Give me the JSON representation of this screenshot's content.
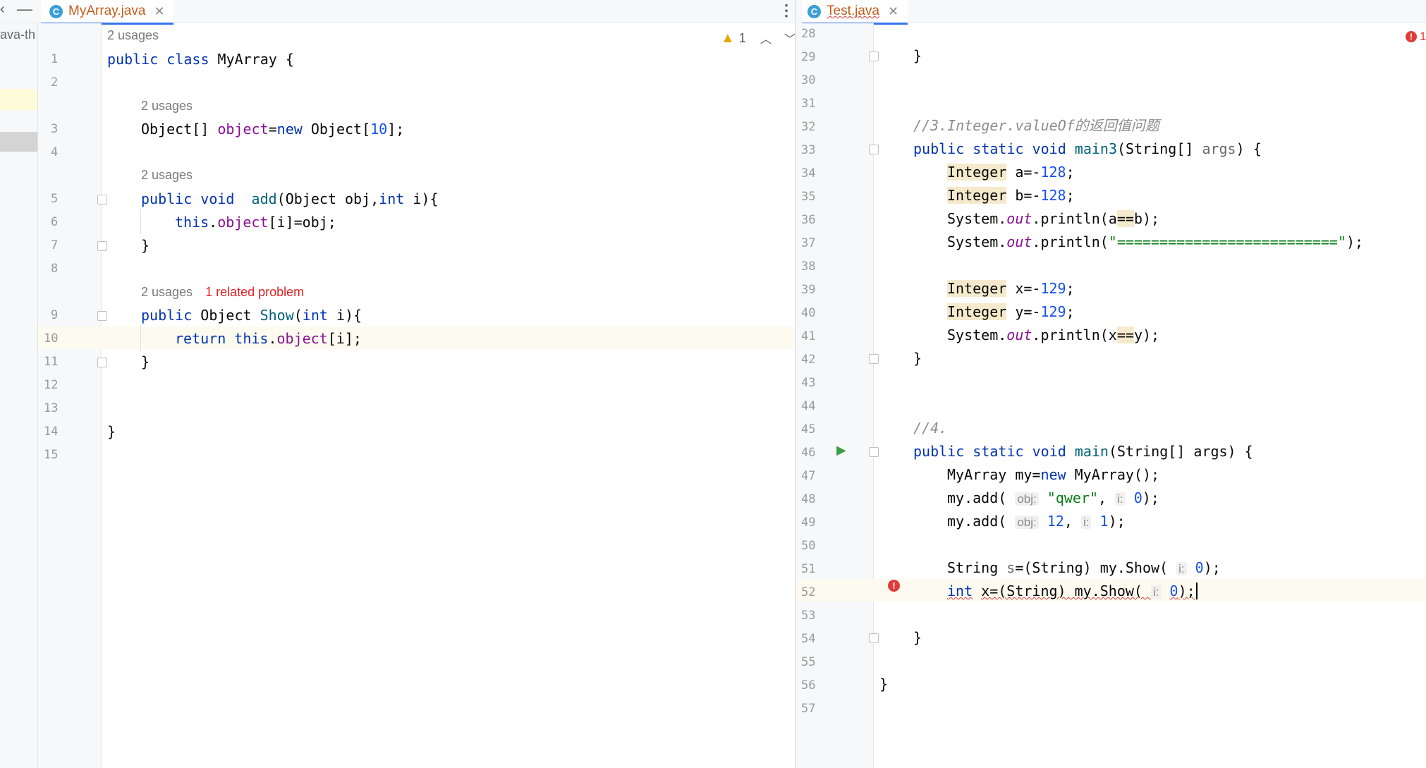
{
  "left_edge": {
    "path_fragment": "ava-th"
  },
  "left_editor": {
    "tab": {
      "label": "MyArray.java",
      "icon": "C"
    },
    "inspection": {
      "warning_count": "1"
    },
    "line_numbers": [
      "1",
      "2",
      "3",
      "4",
      "5",
      "6",
      "7",
      "8",
      "9",
      "10",
      "11",
      "12",
      "13",
      "14",
      "15"
    ],
    "hints": {
      "class_usages": "2 usages",
      "object_usages": "2 usages",
      "add_usages": "2 usages",
      "show_usages": "2 usages",
      "show_problem": "1 related problem"
    }
  },
  "right_editor": {
    "tab": {
      "label": "Test.java",
      "icon": "C"
    },
    "inspection": {
      "error_count": "1"
    },
    "line_numbers": [
      "28",
      "29",
      "30",
      "31",
      "32",
      "33",
      "34",
      "35",
      "36",
      "37",
      "38",
      "39",
      "40",
      "41",
      "42",
      "43",
      "44",
      "45",
      "46",
      "47",
      "48",
      "49",
      "50",
      "51",
      "52",
      "53",
      "54",
      "55",
      "56",
      "57"
    ],
    "comments": {
      "c32": "//3.Integer.valueOf的返回值问题",
      "c45": "//4."
    },
    "string_literals": {
      "s37": "\"==========================\"",
      "s48": "\"qwer\""
    },
    "param_hints": {
      "obj": "obj:",
      "i": "i:"
    }
  },
  "colors": {
    "keyword": "#0033b3",
    "field": "#871094",
    "number": "#1750eb",
    "string": "#067d17",
    "comment": "#8c8c8c",
    "highlight": "#f5eacb",
    "error": "#e03a3a",
    "tab_text": "#c05e1a"
  }
}
